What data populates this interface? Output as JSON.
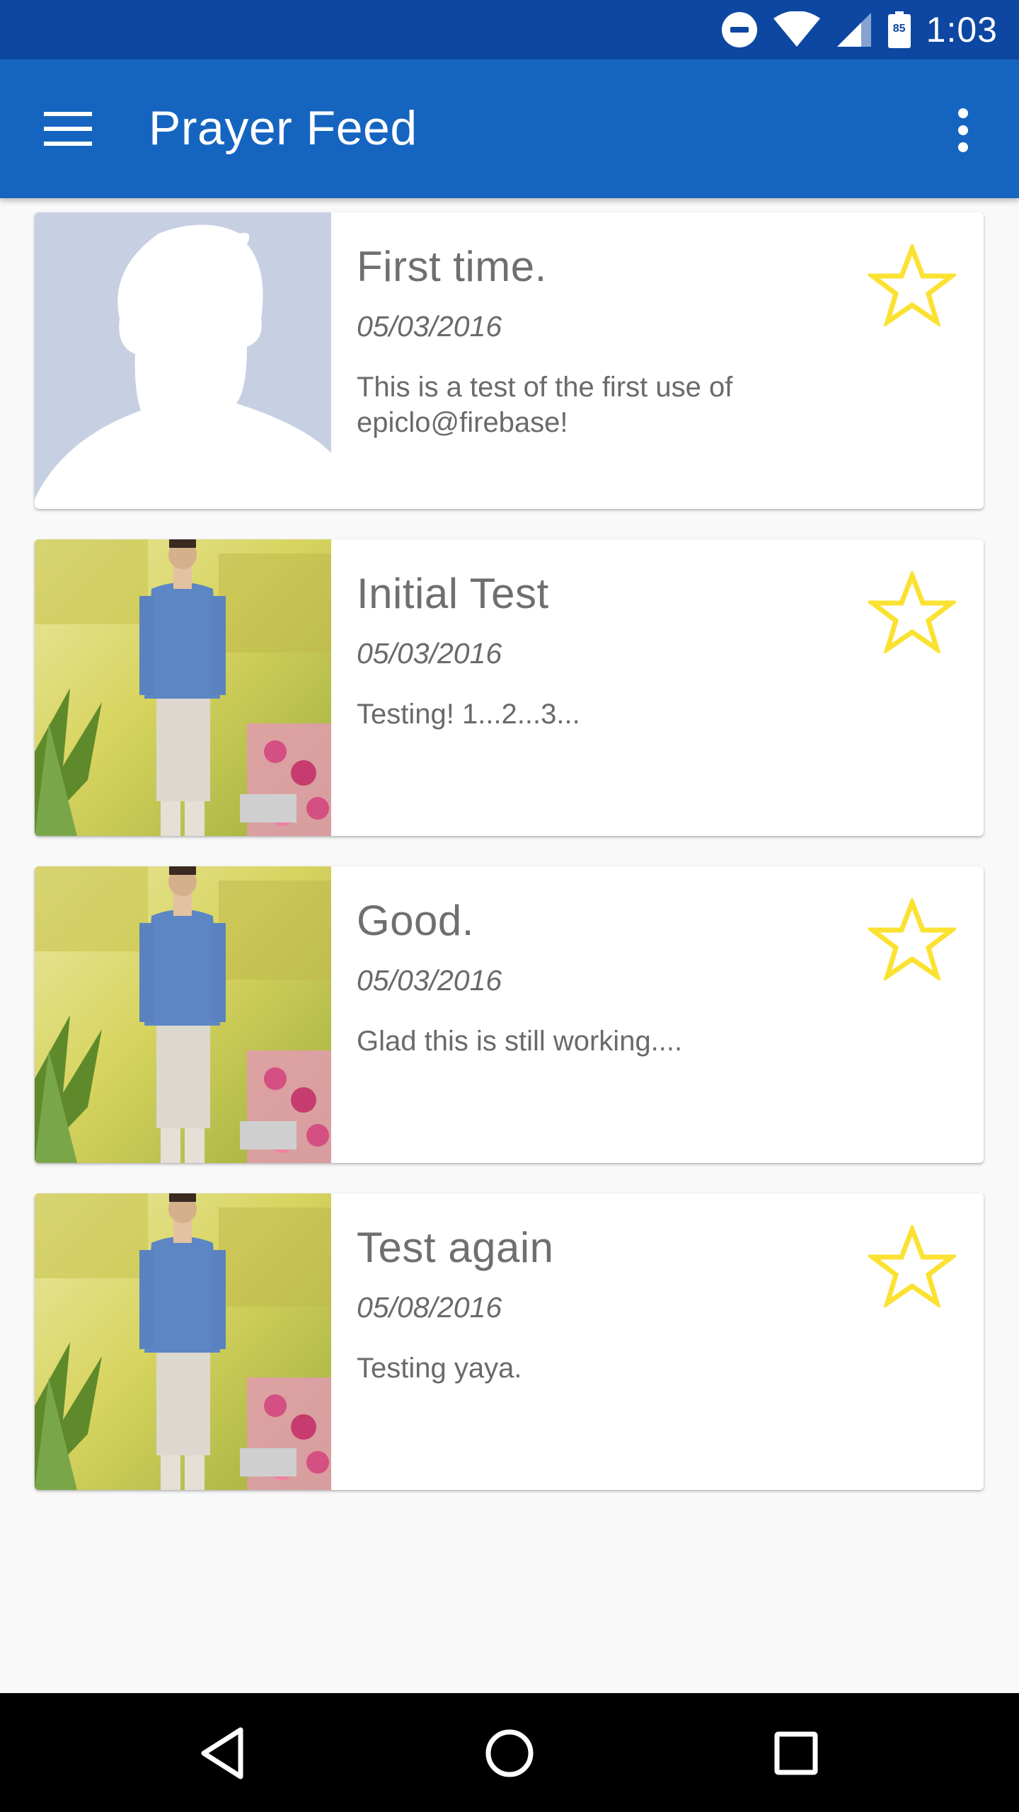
{
  "status_bar": {
    "time": "1:03",
    "battery_level": "85",
    "icons": [
      "do-not-disturb-icon",
      "wifi-icon",
      "signal-icon",
      "battery-icon"
    ]
  },
  "app_bar": {
    "title": "Prayer Feed",
    "menu_icon": "hamburger-menu-icon",
    "overflow_icon": "more-vertical-icon",
    "color": "#1565c0"
  },
  "feed": {
    "items": [
      {
        "title": "First time.",
        "date": "05/03/2016",
        "body": "This is a test of the first use of epiclo@firebase!",
        "photo": "default-avatar",
        "starred": false
      },
      {
        "title": "Initial Test",
        "date": "05/03/2016",
        "body": "Testing! 1...2...3...",
        "photo": "user-photo",
        "starred": false
      },
      {
        "title": "Good.",
        "date": "05/03/2016",
        "body": "Glad this is still working....",
        "photo": "user-photo",
        "starred": false
      },
      {
        "title": "Test again",
        "date": "05/08/2016",
        "body": "Testing yaya.",
        "photo": "user-photo",
        "starred": false
      }
    ],
    "star_color": "#fbe232"
  },
  "nav_bar": {
    "icons": [
      "back-icon",
      "home-icon",
      "recents-icon"
    ]
  }
}
